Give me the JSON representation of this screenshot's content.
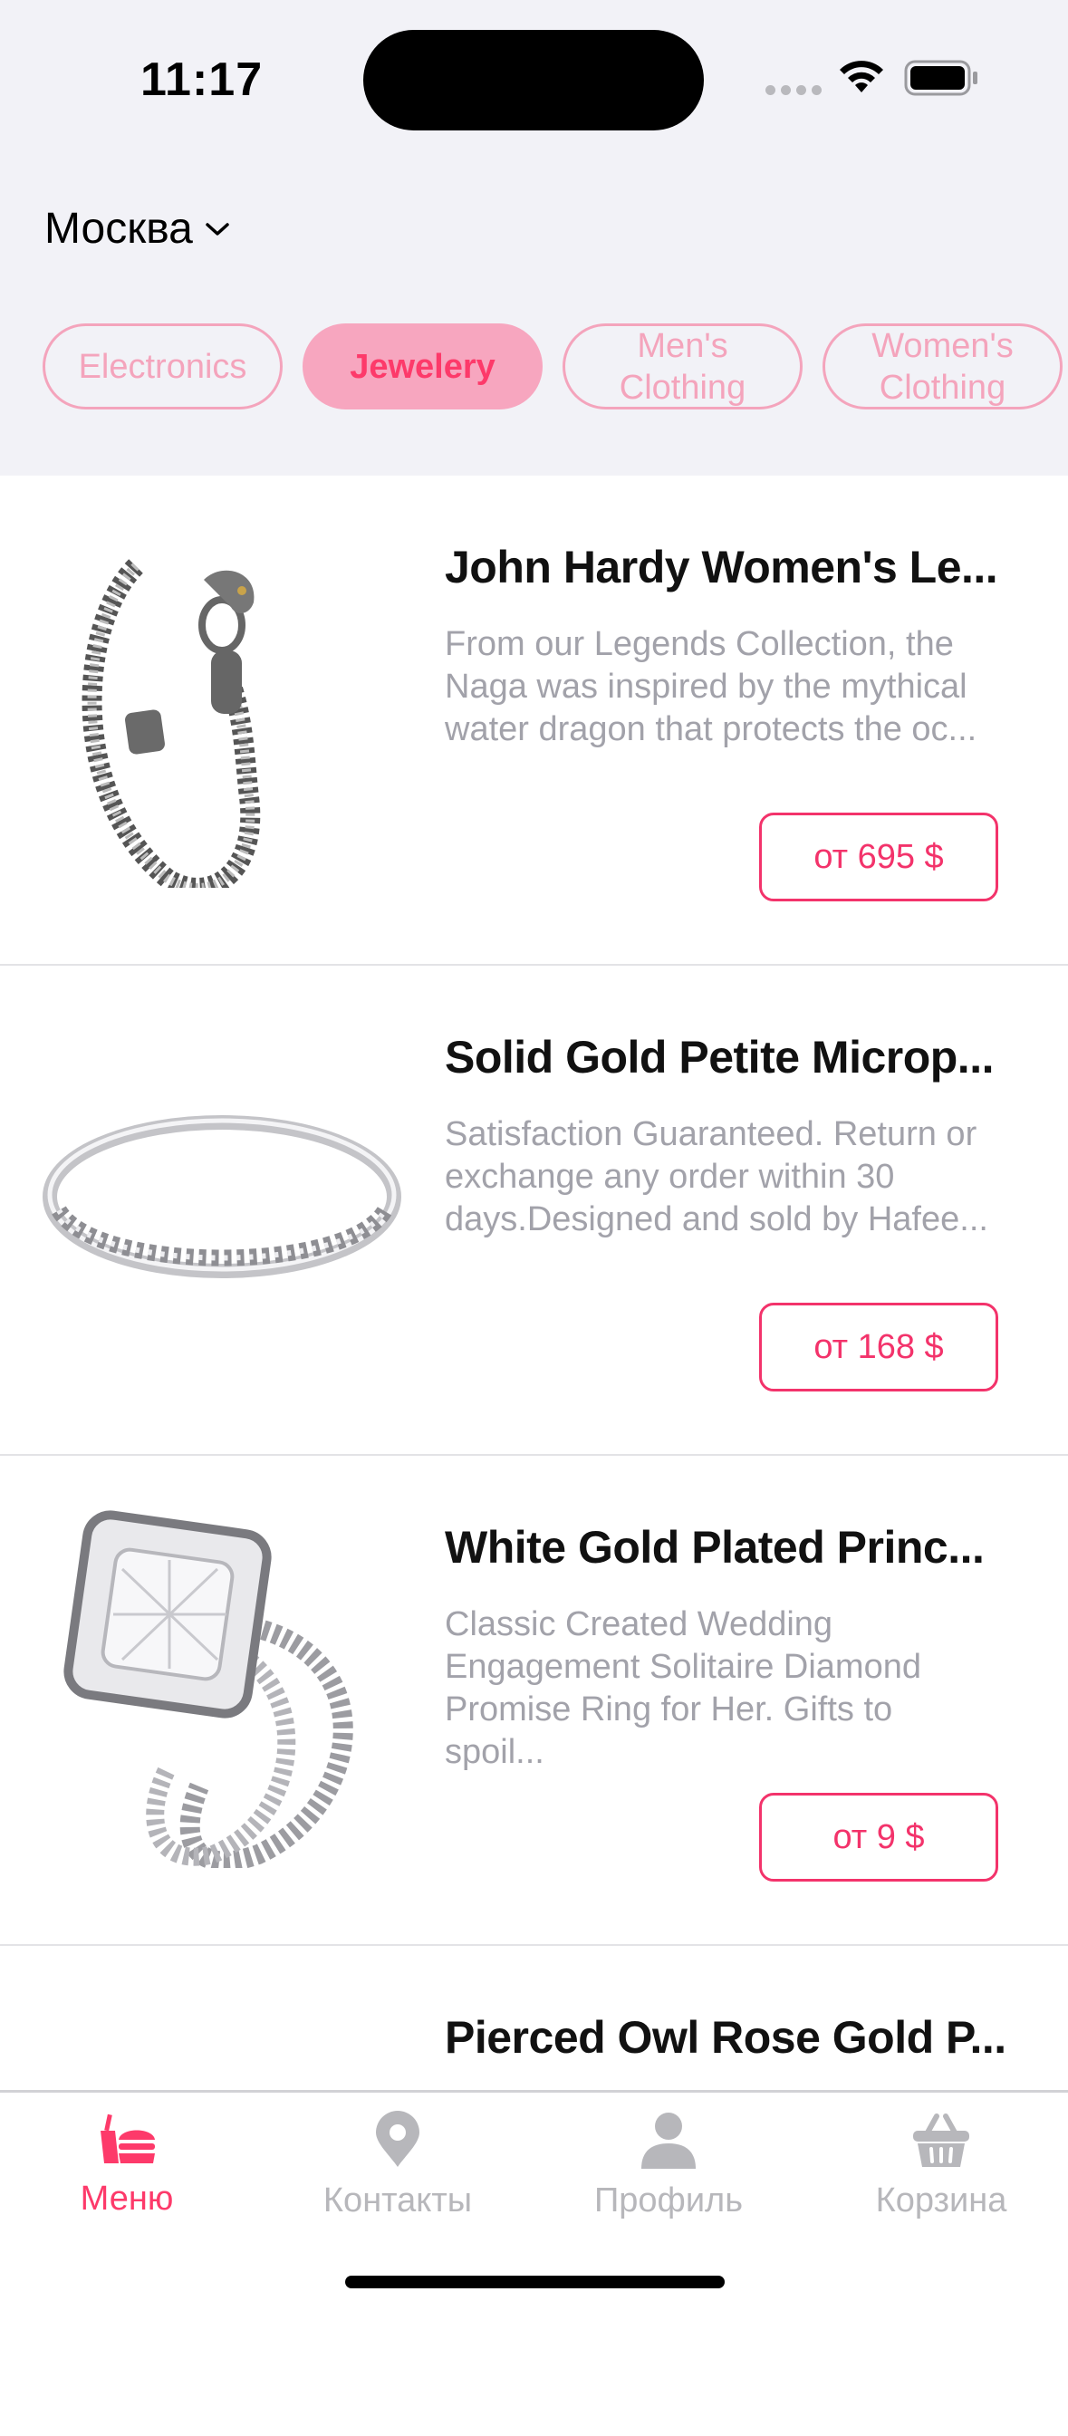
{
  "status_bar": {
    "time": "11:17"
  },
  "header": {
    "city": "Москва"
  },
  "categories": [
    {
      "label": "Electronics",
      "active": false
    },
    {
      "label": "Jewelery",
      "active": true
    },
    {
      "label": "Men's Clothing",
      "active": false
    },
    {
      "label": "Women's Clothing",
      "active": false
    }
  ],
  "products": [
    {
      "title": "John Hardy Women's Le...",
      "description": "From our Legends Collection, the Naga was inspired by the mythical water dragon that protects the oc...",
      "price": "от 695 $"
    },
    {
      "title": "Solid Gold Petite Microp...",
      "description": "Satisfaction Guaranteed. Return or exchange any order within 30 days.Designed and sold by Hafee...",
      "price": "от 168 $"
    },
    {
      "title": "White Gold Plated Princ...",
      "description": "Classic Created Wedding Engagement Solitaire Diamond Promise Ring for Her. Gifts to spoil...",
      "price": "от 9 $"
    },
    {
      "title": "Pierced Owl Rose Gold P..."
    }
  ],
  "tab_bar": {
    "items": [
      {
        "label": "Меню",
        "icon": "food-icon",
        "active": true
      },
      {
        "label": "Контакты",
        "icon": "location-pin-icon",
        "active": false
      },
      {
        "label": "Профиль",
        "icon": "person-icon",
        "active": false
      },
      {
        "label": "Корзина",
        "icon": "basket-icon",
        "active": false
      }
    ]
  },
  "colors": {
    "accent": "#fd3a6a",
    "chip_border": "#f4a4bc",
    "chip_active_bg": "#f7a6bf",
    "inactive_tab": "#b7b7bb",
    "header_bg": "#f2f2f7"
  }
}
